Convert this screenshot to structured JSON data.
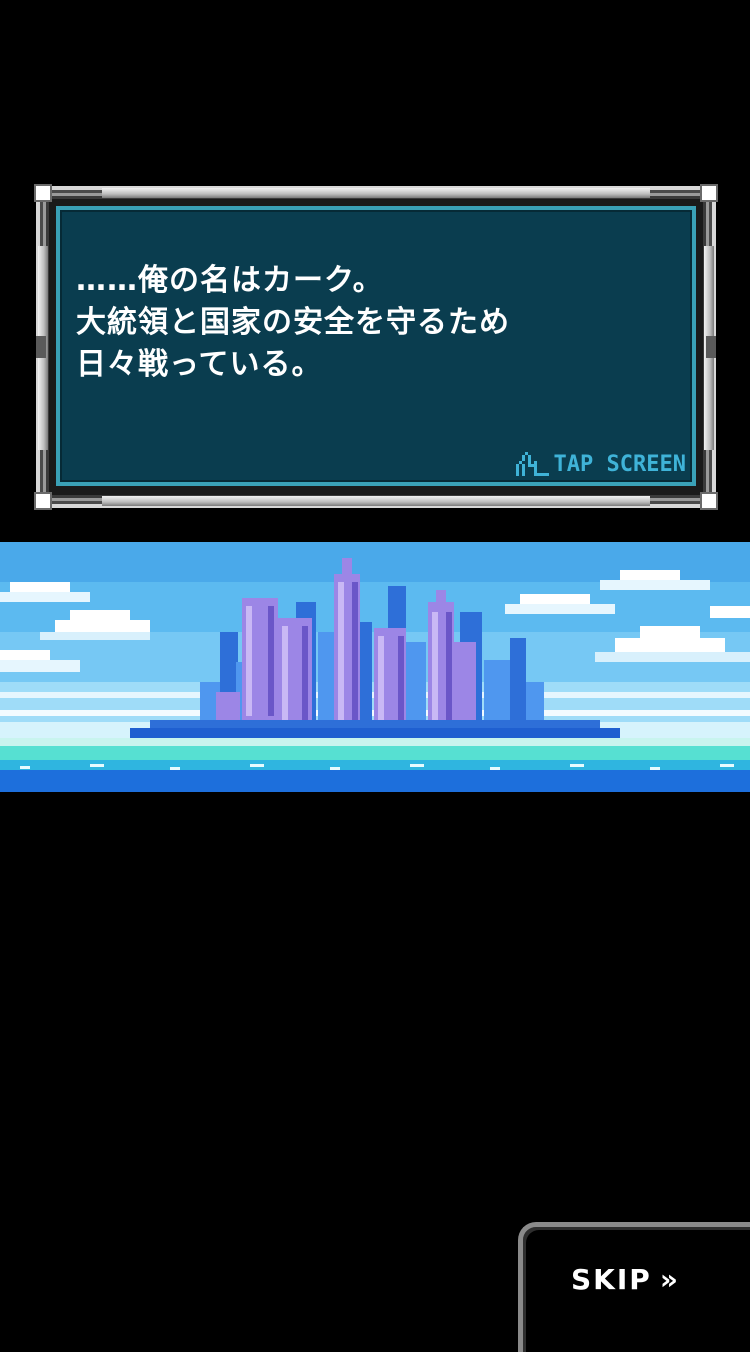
{
  "dialog": {
    "lines": [
      "……俺の名はカーク。",
      "大統領と国家の安全を守るため",
      "日々戦っている。"
    ],
    "tap_label": "TAP SCREEN",
    "tap_icon": "tap-hand-icon"
  },
  "skip": {
    "label": "SKIP",
    "icon": "double-chevron-right-icon",
    "icon_glyph": "»"
  },
  "colors": {
    "background": "#000000",
    "dialog_fill": "#0a3d4f",
    "dialog_border": "#3aa0b6",
    "accent_text": "#3fb3d8",
    "sky": "#4fb4ee",
    "city_purple": "#9c86e6",
    "city_blue": "#2e6fd8",
    "sea": "#1d6fdc"
  }
}
